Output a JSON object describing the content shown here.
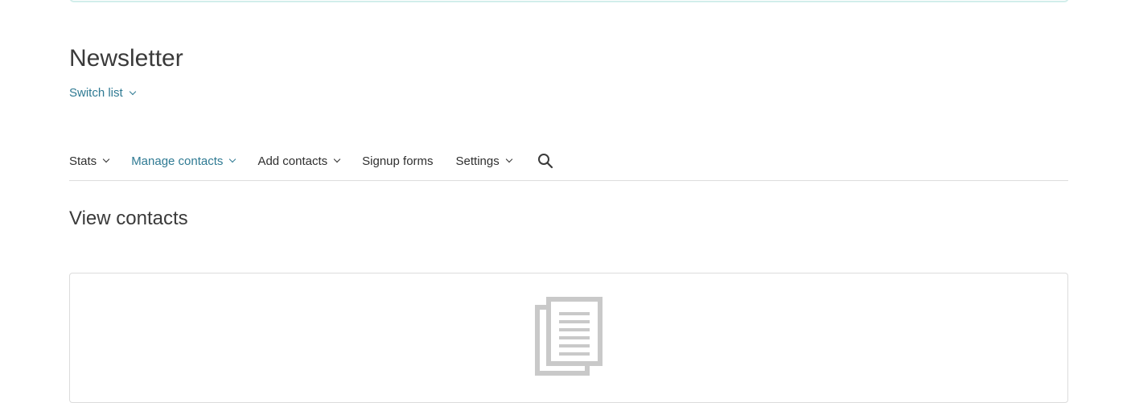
{
  "header": {
    "title": "Newsletter",
    "switch_list_label": "Switch list"
  },
  "nav": {
    "tabs": [
      {
        "label": "Stats",
        "has_dropdown": true,
        "active": false
      },
      {
        "label": "Manage contacts",
        "has_dropdown": true,
        "active": true
      },
      {
        "label": "Add contacts",
        "has_dropdown": true,
        "active": false
      },
      {
        "label": "Signup forms",
        "has_dropdown": false,
        "active": false
      },
      {
        "label": "Settings",
        "has_dropdown": true,
        "active": false
      }
    ],
    "search_icon": "search-icon"
  },
  "main": {
    "section_title": "View contacts",
    "empty_state_icon": "documents-icon"
  },
  "colors": {
    "accent": "#2f7a93",
    "text": "#2f2f2f",
    "banner_border": "#cdece8",
    "icon_gray": "#c9c9c9"
  }
}
